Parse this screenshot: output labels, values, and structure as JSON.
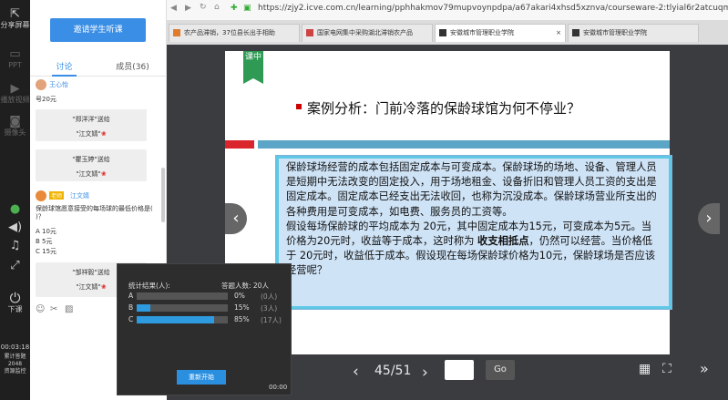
{
  "leftbar": {
    "items": [
      {
        "icon": "screen-share-icon",
        "label": "分享屏幕"
      },
      {
        "icon": "ppt-icon",
        "label": "PPT"
      },
      {
        "icon": "video-icon",
        "label": "播放视频"
      },
      {
        "icon": "camera-icon",
        "label": "摄像头"
      },
      {
        "icon": "mic-icon",
        "label": ""
      },
      {
        "icon": "speaker-icon",
        "label": ""
      },
      {
        "icon": "music-icon",
        "label": ""
      },
      {
        "icon": "expand-icon",
        "label": ""
      },
      {
        "icon": "power-icon",
        "label": "下课"
      }
    ],
    "timer": "00:03:18",
    "stat1": "累计答题",
    "stat2": "2048",
    "stat3": "资源监控"
  },
  "chat": {
    "invite_button": "邀请学生听课",
    "tab_discuss": "讨论",
    "tab_members": "成员(36)",
    "msg1_user": "王心怡",
    "msg1_text": "号20元",
    "gift1_line1": "\"郑洋洋\"送给",
    "gift1_line2": "\"江文婧\"",
    "gift2_line1": "\"瞿玉婷\"送给",
    "gift2_line2": "\"江文婧\"",
    "teacher_tag": "老师",
    "teacher_name": "江文婧",
    "question": "保龄球馆愿意接受的每场球的最低价格是(  )？",
    "optA": "A  10元",
    "optB": "B  5元",
    "optC": "C  15元",
    "gift3_line1": "\"邹祥毅\"送给",
    "gift3_line2": "\"江文婧\""
  },
  "browser": {
    "url": "https://zjy2.icve.com.cn/learning/pphhakmov79mupvoynpdpa/a67akari4xhsd5xznva/courseware-2:tlyial6r2atcuqmgqa",
    "tabs": [
      "农产品滞销，37位县长出手相助",
      "国家电网集中采购湖北滞销农产品",
      "安徽城市管理职业学院",
      "安徽城市管理职业学院"
    ]
  },
  "slide": {
    "badge": "课中",
    "title": "案例分析：门前冷落的保龄球馆为何不停业？",
    "para1": " 保龄球场经营的成本包括固定成本与可变成本。保龄球场的场地、设备、管理人员是短期中无法改变的固定投入，用于场地租金、设备折旧和管理人员工资的支出是固定成本。固定成本已经支出无法收回，也称为沉没成本。保龄球场营业所支出的各种费用是可变成本，如电费、服务员的工资等。",
    "para2a": " 假设每场保龄球的平均成本为     20元，其中固定成本为15元，可变成本为5元。当价格为20元时，收益等于成本，这时称为 ",
    "para2bold": "收支相抵点",
    "para2b": "，仍然可以经营。当价格低于 20元时，收益低于成本。假设现在每场保龄球价格为10元，保龄球场是否应该经营呢？"
  },
  "nav": {
    "page": "45/51",
    "go": "Go"
  },
  "popup": {
    "title": "统计结果(人):",
    "answered": "答题人数: 20人",
    "rows": [
      {
        "label": "A",
        "pct": "0%",
        "count": "(0人)",
        "value": 0
      },
      {
        "label": "B",
        "pct": "15%",
        "count": "(3人)",
        "value": 0.15
      },
      {
        "label": "C",
        "pct": "85%",
        "count": "(17人)",
        "value": 0.85
      }
    ],
    "restart": "重新开始",
    "time": "00:00"
  },
  "colors": {
    "accent": "#3a8ee6",
    "badge": "#2e9a54",
    "bar_red": "#d9252b",
    "bar_blue": "#5ba5c6"
  }
}
